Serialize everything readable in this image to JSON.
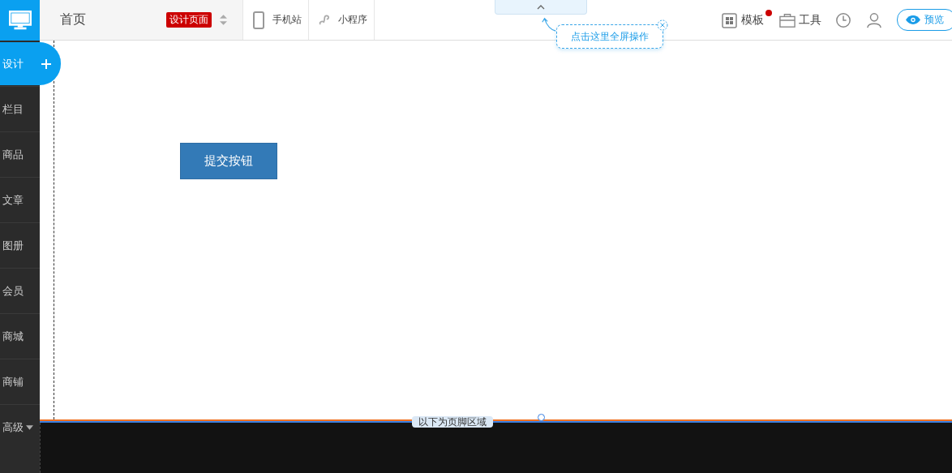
{
  "topbar": {
    "page_title": "首页",
    "page_badge": "设计页面",
    "device_tabs": [
      {
        "label": "手机站",
        "kind": "phone"
      },
      {
        "label": "小程序",
        "kind": "miniapp"
      }
    ],
    "tools": [
      {
        "label": "模板",
        "kind": "template",
        "notify": true
      },
      {
        "label": "工具",
        "kind": "toolbox"
      },
      {
        "kind": "history"
      },
      {
        "kind": "user"
      }
    ],
    "preview_button": "预览"
  },
  "fullscreen_hint": "点击这里全屏操作",
  "sidebar": {
    "items": [
      {
        "label": "设计",
        "selected": true
      },
      {
        "label": "栏目",
        "selected": false
      },
      {
        "label": "商品",
        "selected": false
      },
      {
        "label": "文章",
        "selected": false
      },
      {
        "label": "图册",
        "selected": false
      },
      {
        "label": "会员",
        "selected": false
      },
      {
        "label": "商城",
        "selected": false
      },
      {
        "label": "商铺",
        "selected": false
      },
      {
        "label": "高级",
        "selected": false,
        "dropdown": true
      }
    ]
  },
  "canvas": {
    "submit_button": "提交按钮",
    "footer_label": "以下为页脚区域"
  }
}
